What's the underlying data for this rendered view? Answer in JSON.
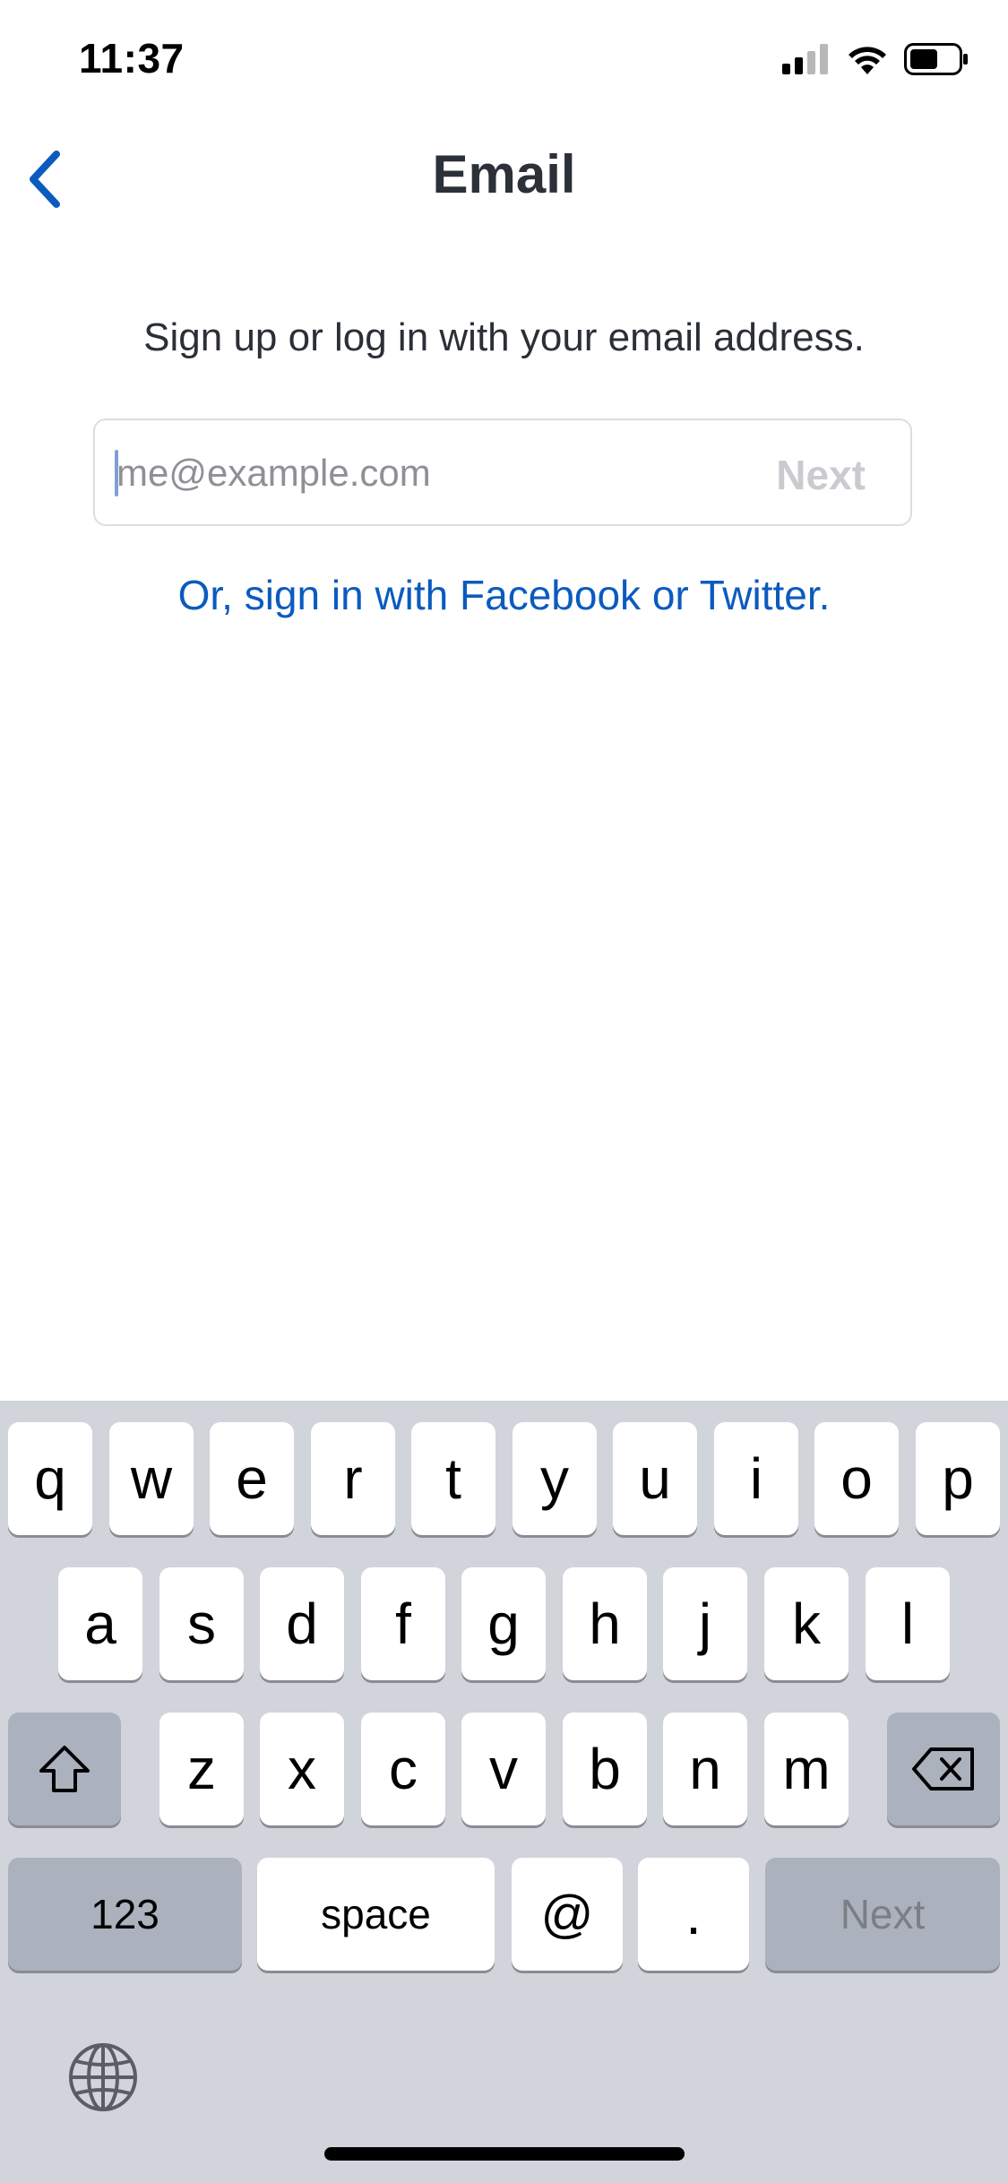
{
  "status_bar": {
    "time": "11:37"
  },
  "nav": {
    "title": "Email"
  },
  "content": {
    "instruction": "Sign up or log in with your email address.",
    "email_placeholder": "me@example.com",
    "email_value": "",
    "next_label": "Next",
    "social_link": "Or, sign in with Facebook or Twitter."
  },
  "keyboard": {
    "row1": [
      "q",
      "w",
      "e",
      "r",
      "t",
      "y",
      "u",
      "i",
      "o",
      "p"
    ],
    "row2": [
      "a",
      "s",
      "d",
      "f",
      "g",
      "h",
      "j",
      "k",
      "l"
    ],
    "row3": [
      "z",
      "x",
      "c",
      "v",
      "b",
      "n",
      "m"
    ],
    "numbers_label": "123",
    "space_label": "space",
    "at_label": "@",
    "period_label": ".",
    "next_label": "Next"
  },
  "colors": {
    "link": "#0b5bbf",
    "back_chevron": "#0b5bbf",
    "keyboard_bg": "#d1d4da"
  },
  "icons": [
    "chevron-left-icon",
    "signal-icon",
    "wifi-icon",
    "battery-icon",
    "shift-icon",
    "backspace-icon",
    "globe-icon"
  ]
}
